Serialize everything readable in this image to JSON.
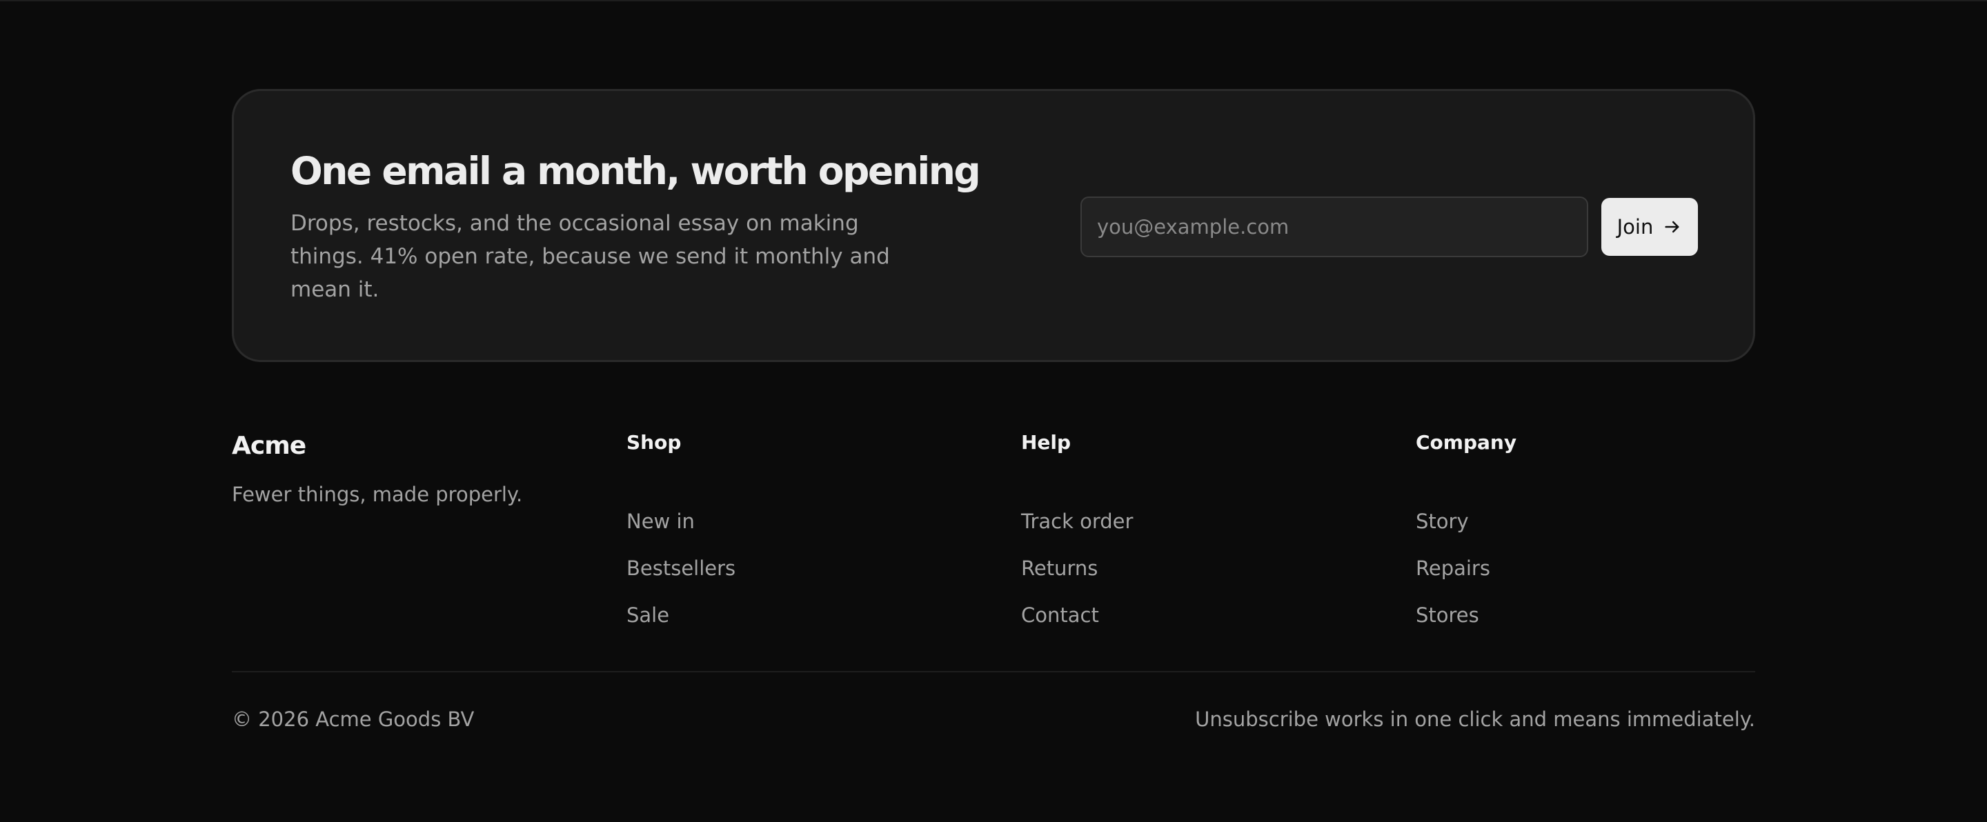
{
  "newsletter": {
    "title": "One email a month, worth opening",
    "description": "Drops, restocks, and the occasional essay on making things. 41% open rate, because we send it monthly and mean it.",
    "email_placeholder": "you@example.com",
    "email_value": "",
    "join_label": "Join",
    "join_icon": "arrow-right-icon"
  },
  "brand": {
    "name": "Acme",
    "tagline": "Fewer things, made properly."
  },
  "columns": [
    {
      "heading": "Shop",
      "links": [
        "New in",
        "Bestsellers",
        "Sale"
      ]
    },
    {
      "heading": "Help",
      "links": [
        "Track order",
        "Returns",
        "Contact"
      ]
    },
    {
      "heading": "Company",
      "links": [
        "Story",
        "Repairs",
        "Stores"
      ]
    }
  ],
  "footer": {
    "copyright": "© 2026 Acme Goods BV",
    "note": "Unsubscribe works in one click and means immediately."
  },
  "colors": {
    "background": "#0b0b0b",
    "card": "#191919",
    "button": "#ececec",
    "muted_text": "#a3a3a3"
  }
}
